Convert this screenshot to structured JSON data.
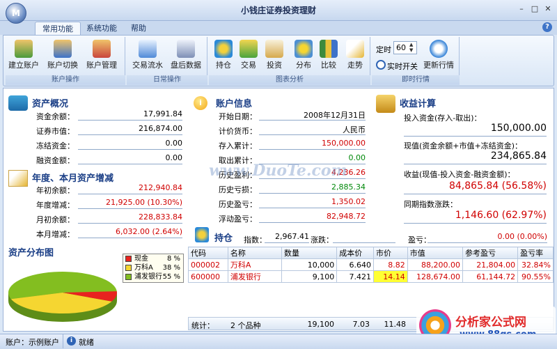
{
  "window": {
    "title": "小钱庄证券投资理财",
    "app_button": "M"
  },
  "tabs": [
    "常用功能",
    "系统功能",
    "帮助"
  ],
  "ribbon": {
    "groups": [
      {
        "caption": "账户操作",
        "buttons": [
          "建立账户",
          "账户切换",
          "账户管理"
        ]
      },
      {
        "caption": "日常操作",
        "buttons": [
          "交易流水",
          "盘后数据"
        ]
      },
      {
        "caption": "图表分析",
        "buttons": [
          "持仓",
          "交易",
          "投资",
          "分布",
          "比较",
          "走势"
        ]
      },
      {
        "caption": "即时行情",
        "timer_label": "定时",
        "timer_value": "60",
        "buttons": [
          "实时开关",
          "更新行情"
        ]
      }
    ]
  },
  "asset_overview": {
    "title": "资产概况",
    "rows": [
      {
        "label": "资金余额：",
        "value": "17,991.84"
      },
      {
        "label": "证券市值：",
        "value": "216,874.00"
      },
      {
        "label": "冻结资金：",
        "value": "0.00"
      },
      {
        "label": "融资金额：",
        "value": "0.00"
      }
    ]
  },
  "annual_change": {
    "title": "年度、本月资产增减",
    "rows": [
      {
        "label": "年初余额：",
        "value": "212,940.84"
      },
      {
        "label": "年度增减：",
        "value": "21,925.00 (10.30%)"
      },
      {
        "label": "月初余额：",
        "value": "228,833.84"
      },
      {
        "label": "本月增减：",
        "value": "6,032.00 (2.64%)"
      }
    ]
  },
  "account_info": {
    "title": "账户信息",
    "rows": [
      {
        "label": "开始日期：",
        "value": "2008年12月31日"
      },
      {
        "label": "计价货币：",
        "value": "人民币"
      },
      {
        "label": "存入累计：",
        "value": "150,000.00"
      },
      {
        "label": "取出累计：",
        "value": "0.00"
      },
      {
        "label": "历史盈利：",
        "value": "4,236.26"
      },
      {
        "label": "历史亏损：",
        "value": "2,885.34"
      },
      {
        "label": "历史盈亏：",
        "value": "1,350.02"
      },
      {
        "label": "浮动盈亏：",
        "value": "82,948.72"
      }
    ]
  },
  "income": {
    "title": "收益计算",
    "invest_label": "投入资金(存入-取出)：",
    "invest_value": "150,000.00",
    "current_label": "现值(资金余额+市值+冻结资金)：",
    "current_value": "234,865.84",
    "profit_label": "收益(现值-投入资金-融资金额)：",
    "profit_value": "84,865.84 (56.58%)",
    "index_label": "同期指数涨跌：",
    "index_value": "1,146.60 (62.97%)"
  },
  "distribution": {
    "title": "资产分布图",
    "legend": [
      {
        "name": "现金",
        "pct": "8 %",
        "color": "#e8231f"
      },
      {
        "name": "万科A",
        "pct": "38 %",
        "color": "#f5d631"
      },
      {
        "name": "浦发银行",
        "pct": "55 %",
        "color": "#83be20"
      }
    ]
  },
  "holdings": {
    "title": "持仓",
    "index_label": "指数：",
    "index_value": "2,967.41",
    "change_label": "涨跌：",
    "change_value": "",
    "pl_label": "盈亏：",
    "pl_value": "0.00 (0.00%)",
    "columns": [
      "代码",
      "名称",
      "数量",
      "成本价",
      "市价",
      "市值",
      "参考盈亏",
      "盈亏率"
    ],
    "rows": [
      [
        "000002",
        "万科A",
        "10,000",
        "6.640",
        "8.82",
        "88,200.00",
        "21,804.00",
        "32.84%"
      ],
      [
        "600000",
        "浦发银行",
        "9,100",
        "7.421",
        "14.14",
        "128,674.00",
        "61,144.72",
        "90.55%"
      ]
    ],
    "totals": [
      "统计：",
      "2 个品种",
      "19,100",
      "7.03",
      "11.48",
      ""
    ]
  },
  "watermark": {
    "site1": "www.DuoTe.com",
    "site2": "分析家公式网",
    "site2_url": "www.88gs.com"
  },
  "status": {
    "account": "账户：示例账户",
    "ready": "就绪"
  }
}
